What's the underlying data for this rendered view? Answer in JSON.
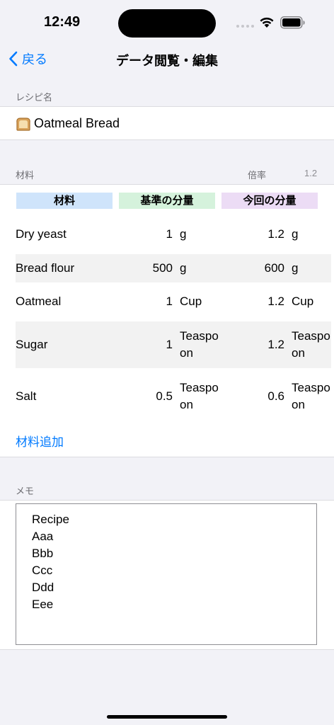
{
  "status_bar": {
    "time": "12:49"
  },
  "nav": {
    "back_label": "戻る",
    "title": "データ閲覧・編集"
  },
  "recipe_section": {
    "header": "レシピ名",
    "name": "Oatmeal Bread",
    "icon": "bread-icon"
  },
  "ingredients_section": {
    "header": "材料",
    "multiplier_label": "倍率",
    "multiplier_value": "1.2",
    "columns": [
      {
        "label": "材料",
        "color": "#cfe4fb"
      },
      {
        "label": "基準の分量",
        "color": "#d5f2dc"
      },
      {
        "label": "今回の分量",
        "color": "#ecdcf5"
      }
    ],
    "rows": [
      {
        "name": "Dry yeast",
        "base_amount": "1",
        "base_unit": "g",
        "current_amount": "1.2",
        "current_unit": "g"
      },
      {
        "name": "Bread flour",
        "base_amount": "500",
        "base_unit": "g",
        "current_amount": "600",
        "current_unit": "g"
      },
      {
        "name": "Oatmeal",
        "base_amount": "1",
        "base_unit": "Cup",
        "current_amount": "1.2",
        "current_unit": "Cup"
      },
      {
        "name": "Sugar",
        "base_amount": "1",
        "base_unit": "Teaspoon",
        "current_amount": "1.2",
        "current_unit": "Teaspoon"
      },
      {
        "name": "Salt",
        "base_amount": "0.5",
        "base_unit": "Teaspoon",
        "current_amount": "0.6",
        "current_unit": "Teaspoon"
      }
    ],
    "add_label": "材料追加"
  },
  "memo_section": {
    "header": "メモ",
    "text": "Recipe\nAaa\nBbb\nCcc\nDdd\nEee"
  },
  "colors": {
    "accent": "#007aff",
    "background": "#f2f2f7",
    "row_alt": "#f2f2f2"
  }
}
